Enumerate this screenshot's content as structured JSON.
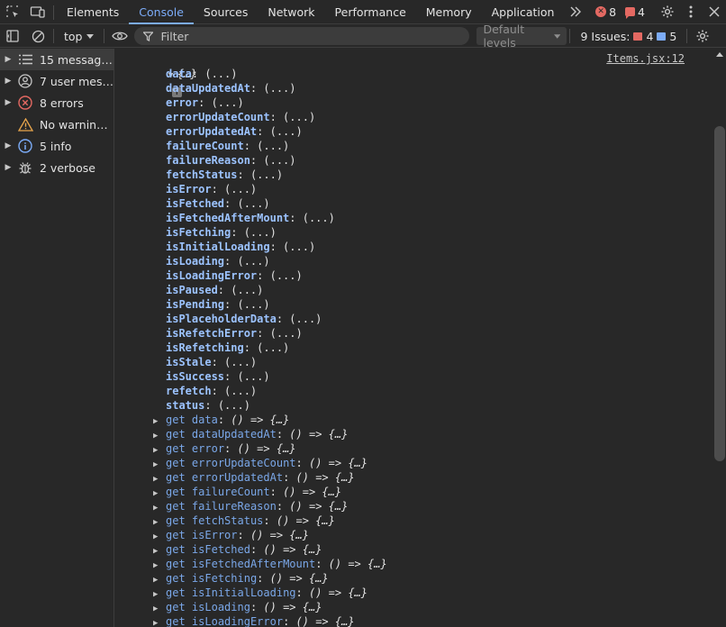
{
  "tabs": [
    "Elements",
    "Console",
    "Sources",
    "Network",
    "Performance",
    "Memory",
    "Application"
  ],
  "active_tab": "Console",
  "header_counts": {
    "errors": "8",
    "warnings": "4"
  },
  "toolbar": {
    "context": "top",
    "filter_placeholder": "Filter",
    "levels": "Default levels",
    "issues_label": "9 Issues:",
    "issues_errors": "4",
    "issues_info": "5"
  },
  "sidebar": {
    "items": [
      {
        "label": "15 messag…",
        "icon": "list-icon"
      },
      {
        "label": "7 user mes…",
        "icon": "user-icon"
      },
      {
        "label": "8 errors",
        "icon": "error-icon"
      },
      {
        "label": "No warnin…",
        "icon": "warning-icon"
      },
      {
        "label": "5 info",
        "icon": "info-icon"
      },
      {
        "label": "2 verbose",
        "icon": "bug-icon"
      }
    ]
  },
  "console": {
    "source_link": "Items.jsx:12",
    "object_preview": "{…}",
    "properties": [
      "data",
      "dataUpdatedAt",
      "error",
      "errorUpdateCount",
      "errorUpdatedAt",
      "failureCount",
      "failureReason",
      "fetchStatus",
      "isError",
      "isFetched",
      "isFetchedAfterMount",
      "isFetching",
      "isInitialLoading",
      "isLoading",
      "isLoadingError",
      "isPaused",
      "isPending",
      "isPlaceholderData",
      "isRefetchError",
      "isRefetching",
      "isStale",
      "isSuccess",
      "refetch",
      "status"
    ],
    "property_value": "(...)",
    "getters": [
      "data",
      "dataUpdatedAt",
      "error",
      "errorUpdateCount",
      "errorUpdatedAt",
      "failureCount",
      "failureReason",
      "fetchStatus",
      "isError",
      "isFetched",
      "isFetchedAfterMount",
      "isFetching",
      "isInitialLoading",
      "isLoading",
      "isLoadingError"
    ],
    "getter_prefix": "get",
    "getter_value": "() => {…}"
  },
  "colors": {
    "accent": "#7cacf8",
    "error": "#e46962",
    "key": "#9cc3ff"
  }
}
